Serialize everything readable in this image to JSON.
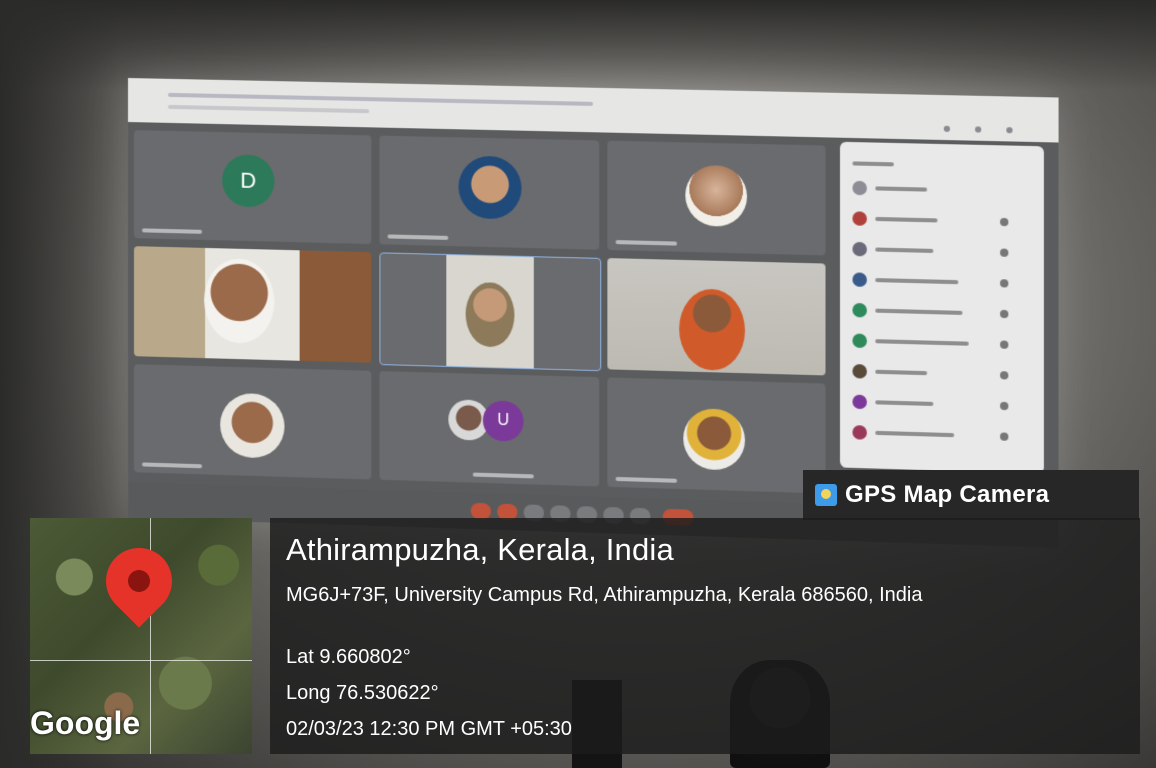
{
  "gps_badge": {
    "title": "GPS Map Camera",
    "icon": "gps-map-camera-logo"
  },
  "map": {
    "provider": "Google",
    "pin_color": "#e5332a"
  },
  "location": {
    "place": "Athirampuzha, Kerala, India",
    "address": "MG6J+73F, University Campus Rd, Athirampuzha, Kerala 686560, India",
    "lat": "Lat 9.660802°",
    "long": "Long 76.530622°",
    "datetime": "02/03/23 12:30 PM GMT +05:30"
  },
  "screen": {
    "tile_avatar_letters": [
      "D",
      "U"
    ]
  }
}
